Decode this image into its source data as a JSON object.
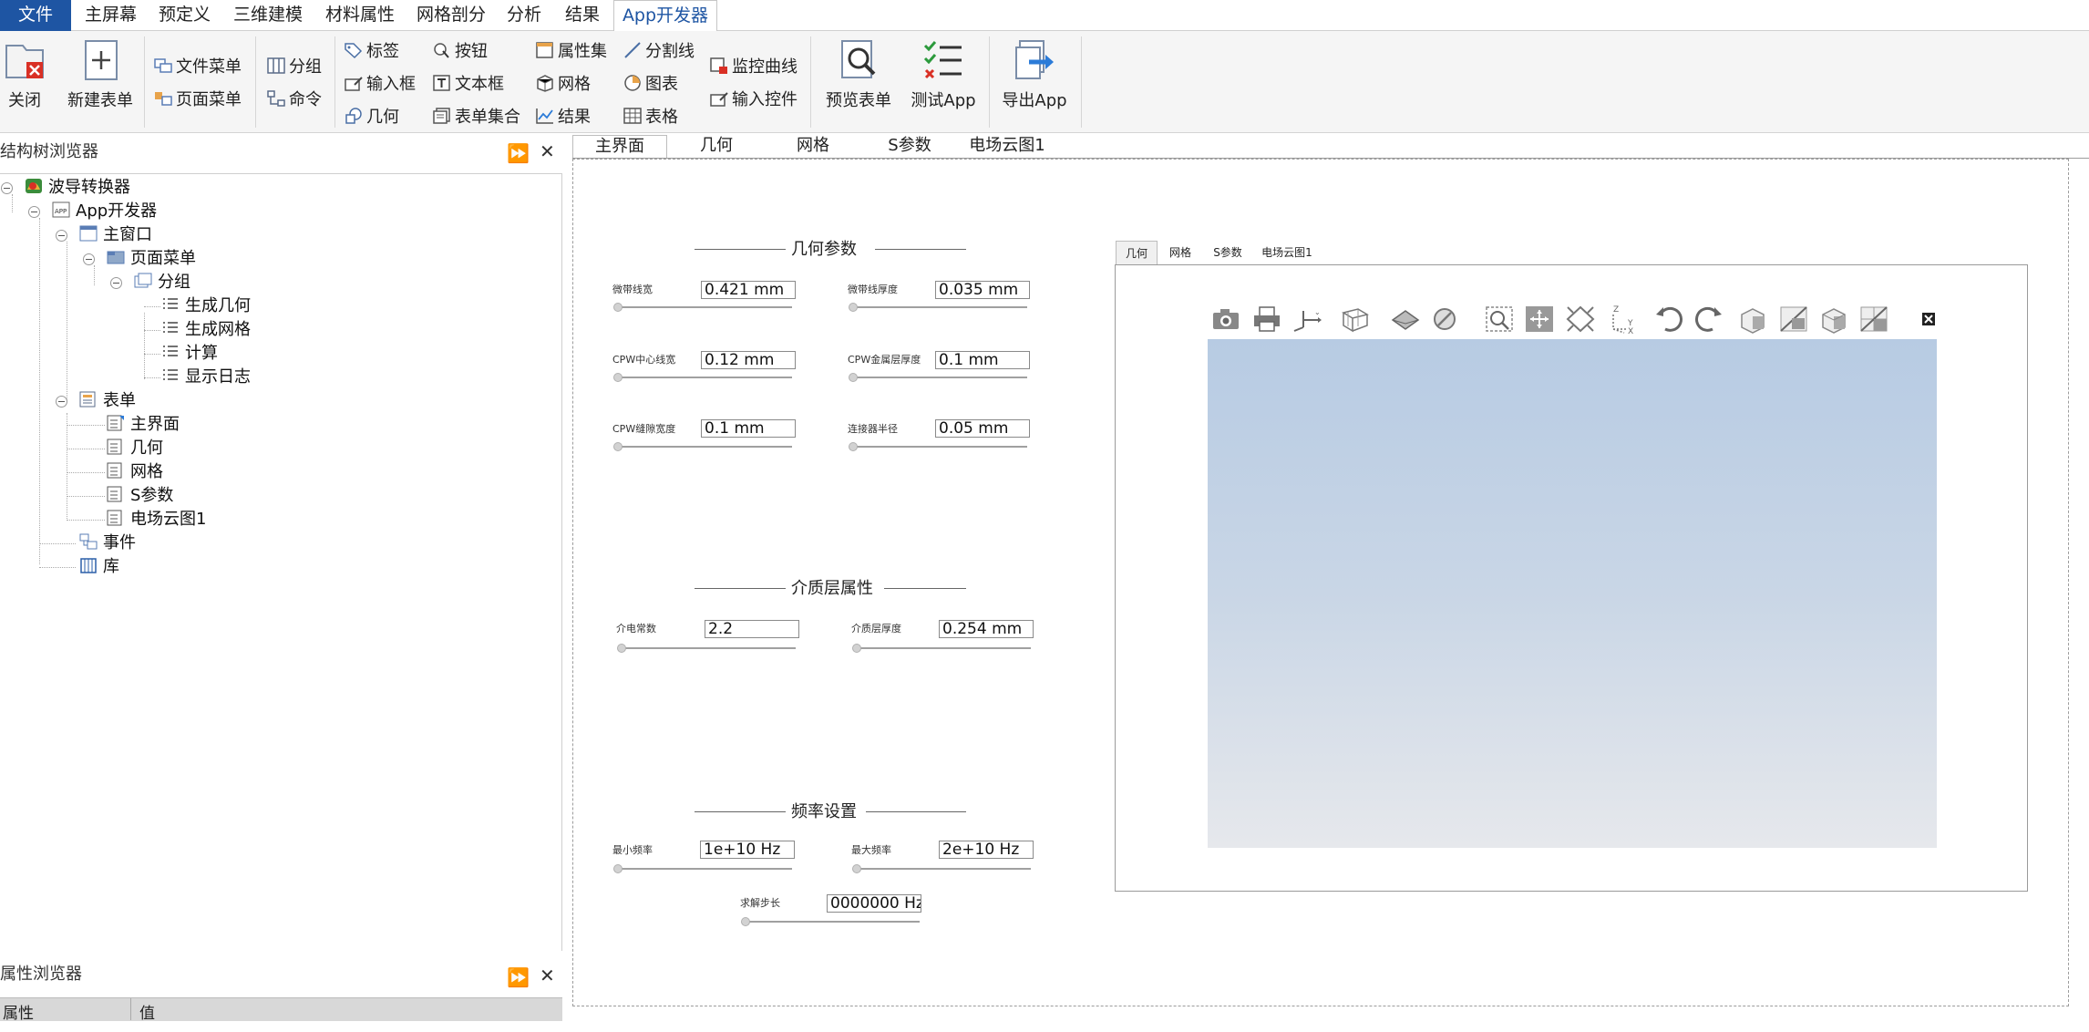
{
  "menu": {
    "items": [
      "文件",
      "主屏幕",
      "预定义",
      "三维建模",
      "材料属性",
      "网格剖分",
      "分析",
      "结果",
      "App开发器"
    ],
    "active": "App开发器"
  },
  "ribbon": {
    "close": "关闭",
    "new_form": "新建表单",
    "file_menu": "文件菜单",
    "page_menu": "页面菜单",
    "group": "分组",
    "command": "命令",
    "label": "标签",
    "input_box": "输入框",
    "geometry": "几何",
    "button": "按钮",
    "textbox": "文本框",
    "form_collection": "表单集合",
    "property_set": "属性集",
    "mesh": "网格",
    "result": "结果",
    "divider": "分割线",
    "chart": "图表",
    "table": "表格",
    "monitor_curve": "监控曲线",
    "input_control": "输入控件",
    "preview_form": "预览表单",
    "test_app": "测试App",
    "export_app": "导出App"
  },
  "tree_panel": {
    "title": "结构树浏览器",
    "nodes": {
      "root": "波导转换器",
      "app": "App开发器",
      "main_window": "主窗口",
      "page_menu": "页面菜单",
      "group": "分组",
      "gen_geometry": "生成几何",
      "gen_mesh": "生成网格",
      "compute": "计算",
      "show_log": "显示日志",
      "forms": "表单",
      "main_ui": "主界面",
      "geometry": "几何",
      "mesh": "网格",
      "sparam": "S参数",
      "efield": "电场云图1",
      "events": "事件",
      "library": "库"
    }
  },
  "prop_panel": {
    "title": "属性浏览器",
    "col_prop": "属性",
    "col_value": "值"
  },
  "doc_tabs": [
    "主界面",
    "几何",
    "网格",
    "S参数",
    "电场云图1"
  ],
  "form": {
    "geo_title": "几何参数",
    "geo_fields": [
      {
        "label": "微带线宽",
        "value": "0.421 mm"
      },
      {
        "label": "微带线厚度",
        "value": "0.035 mm"
      },
      {
        "label": "CPW中心线宽",
        "value": "0.12 mm"
      },
      {
        "label": "CPW金属层厚度",
        "value": "0.1 mm"
      },
      {
        "label": "CPW缝隙宽度",
        "value": "0.1 mm"
      },
      {
        "label": "连接器半径",
        "value": "0.05 mm"
      }
    ],
    "diel_title": "介质层属性",
    "diel_fields": [
      {
        "label": "介电常数",
        "value": "2.2"
      },
      {
        "label": "介质层厚度",
        "value": "0.254 mm"
      }
    ],
    "freq_title": "频率设置",
    "freq_fields": [
      {
        "label": "最小频率",
        "value": "1e+10 Hz"
      },
      {
        "label": "最大频率",
        "value": "2e+10 Hz"
      },
      {
        "label": "求解步长",
        "value": "0000000 Hz"
      }
    ]
  },
  "graphics_tabs": [
    "几何",
    "网格",
    "S参数",
    "电场云图1"
  ],
  "graphics_toolbar": [
    "camera-icon",
    "print-icon",
    "axis-icon",
    "grid-icon",
    "select-icon",
    "hide-icon",
    "zoom-box-icon",
    "zoom-fit-icon",
    "rotate-icon",
    "coordinate-icon",
    "undo-icon",
    "redo-icon",
    "view1-icon",
    "view2-icon",
    "view3-icon",
    "view4-icon",
    "expand-icon"
  ],
  "colors": {
    "accent": "#1e55a3",
    "canvas_top": "#b7cbe3",
    "canvas_bottom": "#e6e8ec"
  }
}
